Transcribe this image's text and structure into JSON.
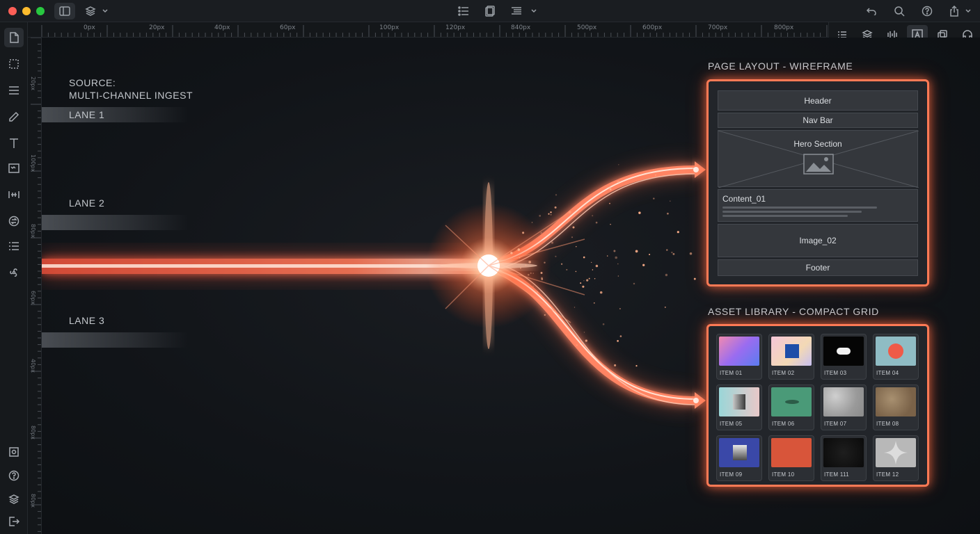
{
  "ruler": {
    "top_labels": [
      "0px",
      "20px",
      "40px",
      "60px",
      "100px",
      "120px",
      "840px",
      "500px",
      "600px",
      "700px",
      "800px"
    ],
    "left_labels": [
      "20px",
      "100px",
      "80px",
      "60px",
      "40px",
      "80px",
      "80px"
    ]
  },
  "canvas": {
    "source_label_line1": "SOURCE:",
    "source_label_line2": "MULTI-CHANNEL INGEST",
    "lanes": [
      "LANE 1",
      "LANE 2",
      "LANE 3"
    ]
  },
  "wireframe": {
    "title": "PAGE LAYOUT - WIREFRAME",
    "header": "Header",
    "nav": "Nav Bar",
    "hero": "Hero Section",
    "content": "Content_01",
    "image": "Image_02",
    "footer": "Footer"
  },
  "assets": {
    "title": "ASSET LIBRARY - COMPACT GRID",
    "items": [
      "ITEM 01",
      "ITEM 02",
      "ITEM 03",
      "ITEM 04",
      "ITEM 05",
      "ITEM 06",
      "ITEM 07",
      "ITEM 08",
      "ITEM 09",
      "ITEM 10",
      "ITEM 111",
      "ITEM 12"
    ]
  },
  "colors": {
    "accent_glow": "#ff7a55",
    "beam_core": "#ffd9c6",
    "canvas_bg": "#111418"
  },
  "icons": {
    "titlebar": [
      "sidebar-toggle-icon",
      "layers-icon",
      "chevron-down-icon",
      "list-icon",
      "copy-icon",
      "align-icon",
      "chevron-down-icon",
      "undo-icon",
      "search-icon",
      "help-icon",
      "share-icon",
      "chevron-down-icon"
    ],
    "rail": [
      "page-icon",
      "marquee-icon",
      "menu-icon",
      "pen-icon",
      "text-icon",
      "image-frame-icon",
      "distribute-icon",
      "swap-icon",
      "list-icon",
      "fan-icon",
      "frame-tag-icon",
      "help-icon",
      "layers-icon",
      "logout-icon"
    ],
    "right_tools": [
      "list-icon",
      "layers-icon",
      "audio-bars-icon",
      "text-box-icon",
      "duplicate-icon",
      "headphones-icon"
    ]
  }
}
